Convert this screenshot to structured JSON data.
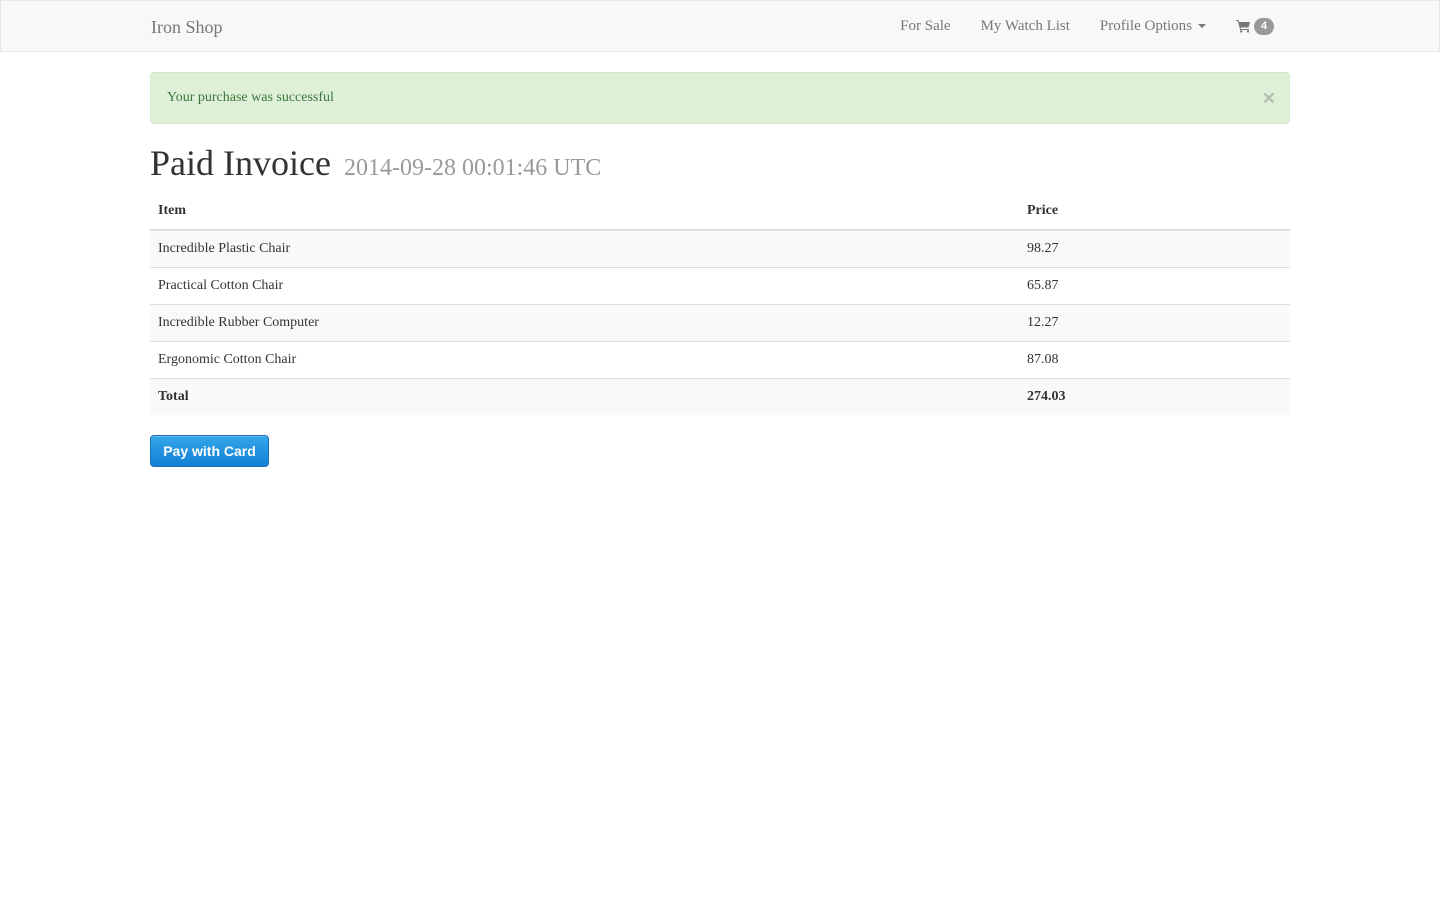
{
  "navbar": {
    "brand": "Iron Shop",
    "links": [
      {
        "label": "For Sale"
      },
      {
        "label": "My Watch List"
      },
      {
        "label": "Profile Options"
      }
    ],
    "cart": {
      "icon": "shopping-cart-icon",
      "count": "4"
    }
  },
  "alert": {
    "message": "Your purchase was successful",
    "close": "×",
    "color": "#dff0d8"
  },
  "invoice": {
    "title": "Paid Invoice",
    "timestamp": "2014-09-28 00:01:46 UTC",
    "columns": {
      "item": "Item",
      "price": "Price"
    },
    "rows": [
      {
        "item": "Incredible Plastic Chair",
        "price": "98.27"
      },
      {
        "item": "Practical Cotton Chair",
        "price": "65.87"
      },
      {
        "item": "Incredible Rubber Computer",
        "price": "12.27"
      },
      {
        "item": "Ergonomic Cotton Chair",
        "price": "87.08"
      }
    ],
    "total": {
      "label": "Total",
      "value": "274.03"
    }
  },
  "pay_button": {
    "label": "Pay with Card",
    "color": "#1a8ae0"
  }
}
